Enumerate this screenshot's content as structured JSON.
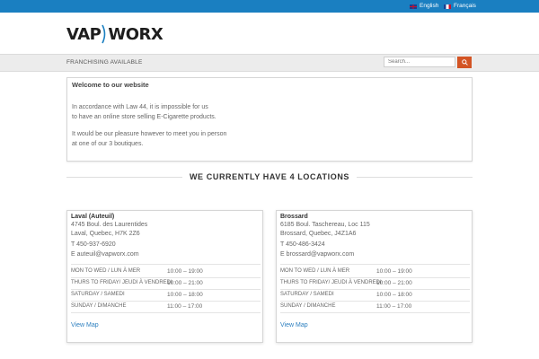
{
  "topbar": {
    "languages": [
      {
        "label": "English",
        "flag": "uk-flag-icon"
      },
      {
        "label": "Français",
        "flag": "france-flag-icon"
      }
    ]
  },
  "logo": {
    "left": "VAP",
    "right": "WORX"
  },
  "nav": {
    "franchising": "FRANCHISING AVAILABLE"
  },
  "search": {
    "placeholder": "Search...",
    "icon": "search-icon"
  },
  "welcome": {
    "title": "Welcome to our website",
    "lines": [
      "In accordance with Law 44, it is impossible for us",
      "to have an online store selling E-Cigarette products.",
      "It would be our pleasure however to meet you in person",
      "at one of our 3 boutiques."
    ]
  },
  "section_title": "WE CURRENTLY HAVE 4 LOCATIONS",
  "locations": [
    {
      "name": "Laval (Auteuil)",
      "address": [
        "4745 Boul. des Laurentides",
        "Laval, Quebec, H7K 2Z6",
        "T 450-937-6920",
        "E auteuil@vapworx.com"
      ],
      "hours": [
        {
          "day": "MON TO WED / LUN À MER",
          "time": "10:00 – 19:00"
        },
        {
          "day": "THURS TO FRIDAY/ JEUDI À VENDREDI",
          "time": "10:00 – 21:00"
        },
        {
          "day": "SATURDAY / SAMEDI",
          "time": "10:00 – 18:00"
        },
        {
          "day": "SUNDAY / DIMANCHE",
          "time": "11:00 – 17:00"
        }
      ],
      "view_map": "View Map"
    },
    {
      "name": "Brossard",
      "address": [
        "6185 Boul. Taschereau, Loc 115",
        "Brossard, Quebec, J4Z1A6",
        "T 450-486-3424",
        "E brossard@vapworx.com"
      ],
      "hours": [
        {
          "day": "MON TO WED / LUN À MER",
          "time": "10:00 – 19:00"
        },
        {
          "day": "THURS TO FRIDAY/ JEUDI À VENDREDI",
          "time": "10:00 – 21:00"
        },
        {
          "day": "SATURDAY / SAMEDI",
          "time": "10:00 – 18:00"
        },
        {
          "day": "SUNDAY / DIMANCHE",
          "time": "11:00 – 17:00"
        }
      ],
      "view_map": "View Map"
    }
  ],
  "colors": {
    "topbar": "#1a7fc1",
    "accent": "#d35424",
    "link": "#2c7fbf"
  }
}
